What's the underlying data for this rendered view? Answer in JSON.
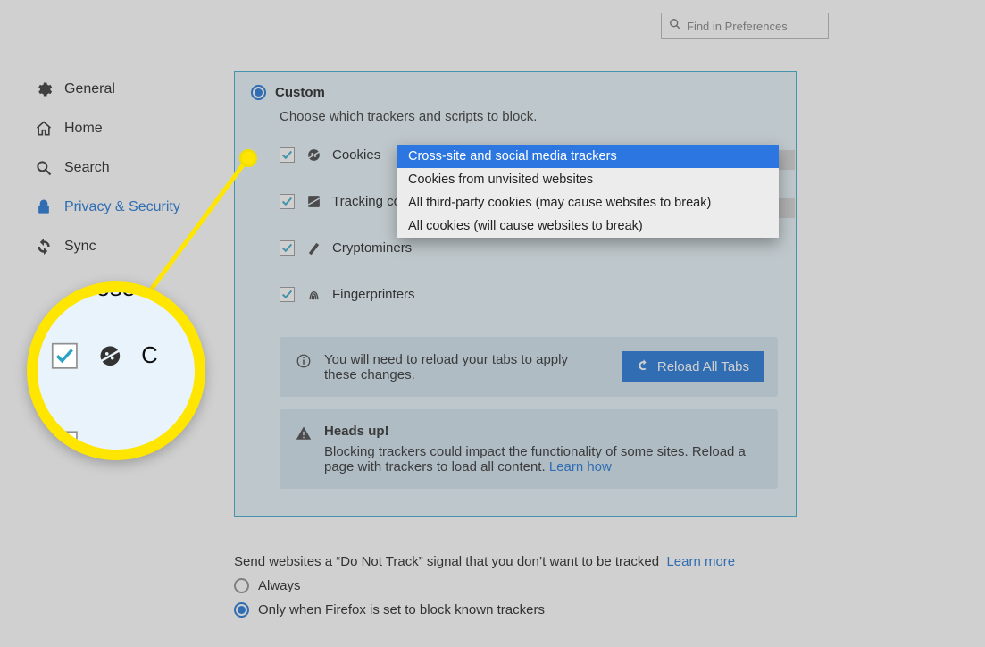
{
  "search": {
    "placeholder": "Find in Preferences"
  },
  "sidebar": {
    "items": [
      {
        "label": "General"
      },
      {
        "label": "Home"
      },
      {
        "label": "Search"
      },
      {
        "label": "Privacy & Security"
      },
      {
        "label": "Sync"
      }
    ]
  },
  "panel": {
    "mode_label": "Custom",
    "desc": "Choose which trackers and scripts to block.",
    "options": [
      {
        "label": "Cookies"
      },
      {
        "label": "Tracking con"
      },
      {
        "label": "Cryptominers"
      },
      {
        "label": "Fingerprinters"
      }
    ],
    "dropdown": [
      "Cross-site and social media trackers",
      "Cookies from unvisited websites",
      "All third-party cookies (may cause websites to break)",
      "All cookies (will cause websites to break)"
    ],
    "reload_notice": "You will need to reload your tabs to apply these changes.",
    "reload_button": "Reload All Tabs",
    "headsup_title": "Heads up!",
    "headsup_text": "Blocking trackers could impact the functionality of some sites. Reload a page with trackers to load all content.  ",
    "headsup_link": "Learn how"
  },
  "zoom": {
    "text": "Choose",
    "opt1": "C"
  },
  "dnt": {
    "text": "Send websites a “Do Not Track” signal that you don’t want to be tracked",
    "learn": "Learn more",
    "opt_always": "Always",
    "opt_known": "Only when Firefox is set to block known trackers"
  }
}
